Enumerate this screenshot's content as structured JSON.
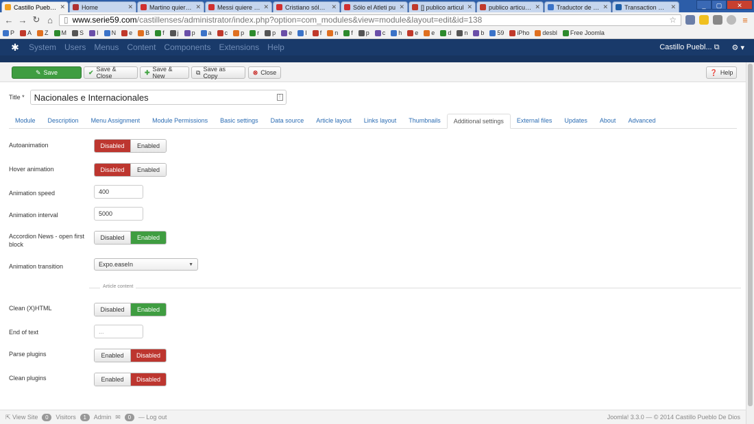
{
  "browser": {
    "tabs": [
      {
        "label": "Castillo Pueblo D",
        "color": "#f0a020",
        "active": true
      },
      {
        "label": "Home",
        "color": "#b03030"
      },
      {
        "label": "Martino quiere d",
        "color": "#d03030"
      },
      {
        "label": "Messi quiere gan",
        "color": "#d03030"
      },
      {
        "label": "Cristiano sólo pi",
        "color": "#d03030"
      },
      {
        "label": "Sólo el Atleti pu",
        "color": "#d03030"
      },
      {
        "label": "[] publico articul",
        "color": "#c0392b"
      },
      {
        "label": "publico articulos",
        "color": "#c0392b"
      },
      {
        "label": "Traductor de Go",
        "color": "#3b73c8"
      },
      {
        "label": "Transaction Deta",
        "color": "#1f5fa8"
      }
    ],
    "url_host": "www.serie59.com",
    "url_rest": "/castillenses/administrator/index.php?option=com_modules&view=module&layout=edit&id=138",
    "bookmarks": [
      "P",
      "A",
      "Z",
      "M",
      "S",
      "I",
      "N",
      "e",
      "B",
      "f",
      "j",
      "p",
      "a",
      "c",
      "p",
      "r",
      "p",
      "e",
      "I",
      "f",
      "n",
      "f",
      "p",
      "c",
      "h",
      "e",
      "e",
      "d",
      "n",
      "b",
      "59",
      "iPho",
      "desbl",
      "Free Joomla"
    ]
  },
  "joomla_nav": {
    "items": [
      "System",
      "Users",
      "Menus",
      "Content",
      "Components",
      "Extensions",
      "Help"
    ],
    "site_name": "Castillo Puebl..."
  },
  "toolbar": {
    "save": "Save",
    "save_close": "Save & Close",
    "save_new": "Save & New",
    "save_copy": "Save as Copy",
    "close": "Close",
    "help": "Help"
  },
  "form": {
    "title_label": "Title *",
    "title_value": "Nacionales e Internacionales"
  },
  "tabs": [
    "Module",
    "Description",
    "Menu Assignment",
    "Module Permissions",
    "Basic settings",
    "Data source",
    "Article layout",
    "Links layout",
    "Thumbnails",
    "Additional settings",
    "External files",
    "Updates",
    "About",
    "Advanced"
  ],
  "active_tab": "Additional settings",
  "settings": {
    "autoanimation": {
      "label": "Autoanimation",
      "opt1": "Disabled",
      "opt2": "Enabled",
      "selected": "Disabled"
    },
    "hover_animation": {
      "label": "Hover animation",
      "opt1": "Disabled",
      "opt2": "Enabled",
      "selected": "Disabled"
    },
    "animation_speed": {
      "label": "Animation speed",
      "value": "400"
    },
    "animation_interval": {
      "label": "Animation interval",
      "value": "5000"
    },
    "accordion": {
      "label": "Accordion News - open first block",
      "opt1": "Disabled",
      "opt2": "Enabled",
      "selected": "Enabled"
    },
    "animation_transition": {
      "label": "Animation transition",
      "value": "Expo.easeIn"
    },
    "section_label": "Article content",
    "clean_xhtml": {
      "label": "Clean (X)HTML",
      "opt1": "Disabled",
      "opt2": "Enabled",
      "selected": "Enabled"
    },
    "end_of_text": {
      "label": "End of text",
      "placeholder": "..."
    },
    "parse_plugins": {
      "label": "Parse plugins",
      "opt1": "Enabled",
      "opt2": "Disabled",
      "selected": "Disabled"
    },
    "clean_plugins": {
      "label": "Clean plugins",
      "opt1": "Enabled",
      "opt2": "Disabled",
      "selected": "Disabled"
    }
  },
  "status": {
    "view_site": "View Site",
    "visitors_count": "0",
    "visitors": "Visitors",
    "admin_count": "1",
    "admin": "Admin",
    "messages_count": "0",
    "logout": "Log out",
    "footer": "Joomla! 3.3.0 — © 2014 Castillo Pueblo De Dios"
  }
}
